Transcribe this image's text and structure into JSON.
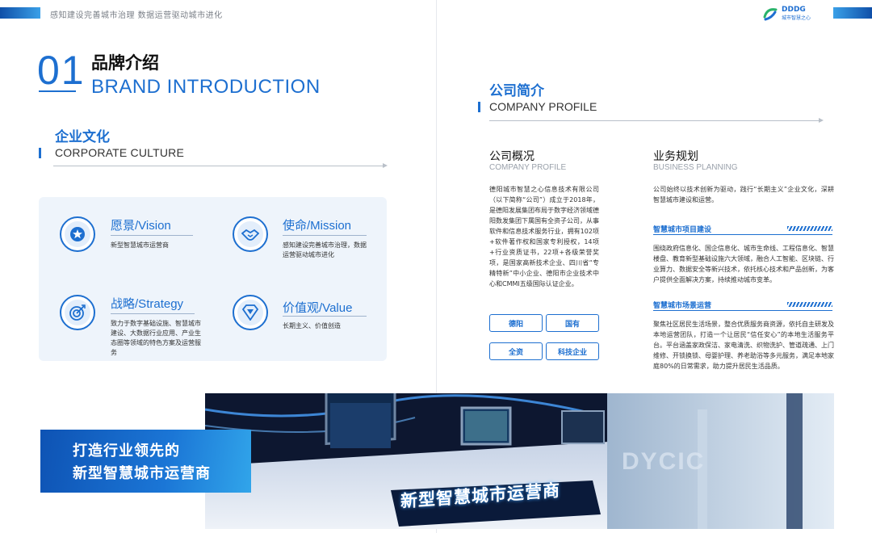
{
  "header": {
    "slogan": "感知建设完善城市治理  数据运营驱动城市进化",
    "logo_text": "DDDG",
    "logo_sub": "城市智慧之心"
  },
  "brand": {
    "number": "01",
    "title_cn": "品牌介绍",
    "title_en": "BRAND INTRODUCTION"
  },
  "culture": {
    "title_cn": "企业文化",
    "title_en": "CORPORATE CULTURE",
    "items": [
      {
        "cn": "愿景",
        "en": "/Vision",
        "desc": "新型智慧城市运营商",
        "icon": "star-icon"
      },
      {
        "cn": "使命",
        "en": "/Mission",
        "desc": "感知建设完善城市治理，数据运营驱动城市进化",
        "icon": "handshake-icon"
      },
      {
        "cn": "战略",
        "en": "/Strategy",
        "desc": "致力于数字基础设施、智慧城市建设、大数据行业应用、产业生态圈等领域的特色方案及运营服务",
        "icon": "target-icon"
      },
      {
        "cn": "价值观",
        "en": "/Value",
        "desc": "长期主义、价值创造",
        "icon": "diamond-icon"
      }
    ]
  },
  "banner": {
    "line1": "打造行业领先的",
    "line2": "新型智慧城市运营商"
  },
  "photo": {
    "sign_text": "新型智慧城市运营商",
    "wall_text": "DYCIC"
  },
  "company": {
    "title_cn": "公司简介",
    "title_en": "COMPANY PROFILE",
    "overview": {
      "title_cn": "公司概况",
      "title_en": "COMPANY PROFILE",
      "body": "德阳城市智慧之心信息技术有限公司（以下简称“公司”）成立于2018年，是德阳发展集团布局于数字经济领域德阳数发集团下属国有全资子公司，从事软件和信息技术服务行业，拥有102项+软件著作权和国家专利授权，14项+行业资质证书，22项+各级荣誉奖项，是国家高新技术企业、四川省“专精特新”中小企业、德阳市企业技术中心和CMMI五级国际认证企业。",
      "tags": [
        "德阳",
        "国有",
        "全资",
        "科技企业"
      ]
    },
    "planning": {
      "title_cn": "业务规划",
      "title_en": "BUSINESS PLANNING",
      "intro": "公司始终以技术创新为驱动，践行“长期主义”企业文化，深耕智慧城市建设和运营。",
      "sections": [
        {
          "title": "智慧城市项目建设",
          "body": "围绕政府信息化、国企信息化、城市生命线、工程信息化、智慧楼盘、教育新型基础设施六大领域，融合人工智能、区块链、行业算力、数据安全等新兴技术，依托核心技术和产品创新，为客户提供全面解决方案，持续推动城市变革。"
        },
        {
          "title": "智慧城市场景运营",
          "body": "聚焦社区居民生活场景，整合优质服务商资源，依托自主研发及本地运营团队，打造一个让居民“信任安心”的本地生活服务平台。平台涵盖家政保洁、家电清洗、织物洗护、管道疏通、上门维修、开锁换锁、母婴护理、养老助浴等多元服务，满足本地家庭80%的日常需求，助力提升居民生活品质。"
        }
      ]
    }
  },
  "colors": {
    "accent": "#1d6fd0",
    "panel": "#eef4fb",
    "banner": "#1b76d6"
  }
}
